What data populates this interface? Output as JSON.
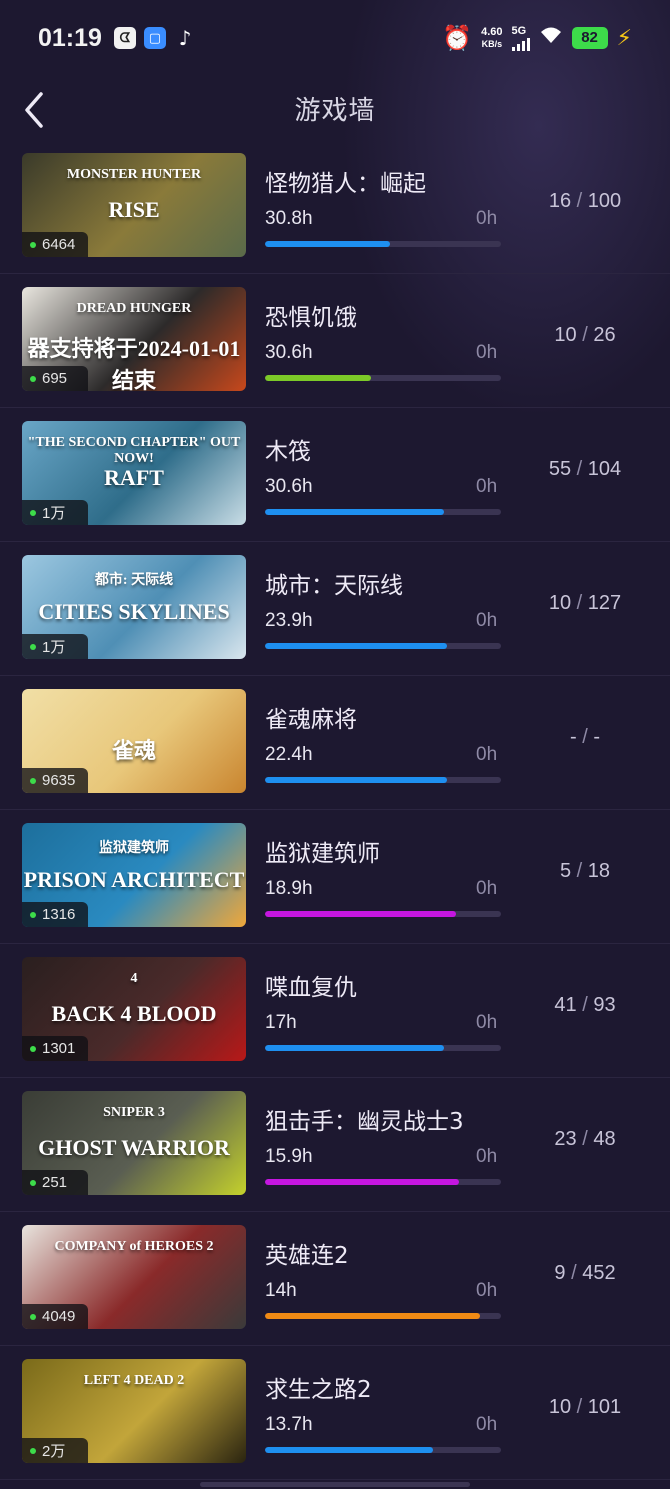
{
  "status_bar": {
    "time": "01:19",
    "app_icons": [
      "ᗧ",
      "▢",
      "♪"
    ],
    "net_speed_value": "4.60",
    "net_speed_unit": "KB/s",
    "network": "5G",
    "battery": "82"
  },
  "header": {
    "title": "游戏墙",
    "back_icon": "chevron-left-icon"
  },
  "colors": {
    "background": "#1d1830",
    "bar_blue": "#1e8ff0",
    "bar_green": "#7cc928",
    "bar_purple": "#c516e0",
    "bar_orange": "#f08a14",
    "track": "#3a3452",
    "online_dot": "#3ddc4a"
  },
  "games": [
    {
      "name": "怪物猎人：崛起",
      "hours": "30.8h",
      "recent": "0h",
      "online": "6464",
      "ach_done": "16",
      "ach_total": "100",
      "progress": 0.53,
      "bar_color": "#1e8ff0",
      "art": {
        "title_line1": "MONSTER HUNTER",
        "title_line2": "RISE",
        "palette": [
          "#3a3a2a",
          "#8a7a3a",
          "#5a6a4a"
        ]
      }
    },
    {
      "name": "恐惧饥饿",
      "hours": "30.6h",
      "recent": "0h",
      "online": "695",
      "ach_done": "10",
      "ach_total": "26",
      "progress": 0.45,
      "bar_color": "#7cc928",
      "art": {
        "title_line1": "DREAD HUNGER",
        "title_line2": "器支持将于2024-01-01结束",
        "palette": [
          "#e9e6df",
          "#2c2a2a",
          "#c7481c"
        ]
      }
    },
    {
      "name": "木筏",
      "hours": "30.6h",
      "recent": "0h",
      "online": "1万",
      "ach_done": "55",
      "ach_total": "104",
      "progress": 0.76,
      "bar_color": "#1e8ff0",
      "art": {
        "title_line1": "\"THE SECOND CHAPTER\" OUT NOW!",
        "title_line2": "RAFT",
        "palette": [
          "#6aa6c7",
          "#2f6d8a",
          "#c9dde6"
        ]
      }
    },
    {
      "name": "城市：天际线",
      "hours": "23.9h",
      "recent": "0h",
      "online": "1万",
      "ach_done": "10",
      "ach_total": "127",
      "progress": 0.77,
      "bar_color": "#1e8ff0",
      "art": {
        "title_line1": "都市: 天际线",
        "title_line2": "CITIES SKYLINES",
        "palette": [
          "#9cc7e0",
          "#4f8fb5",
          "#d9e6ee"
        ]
      }
    },
    {
      "name": "雀魂麻将",
      "hours": "22.4h",
      "recent": "0h",
      "online": "9635",
      "ach_done": "-",
      "ach_total": "-",
      "progress": 0.77,
      "bar_color": "#1e8ff0",
      "art": {
        "title_line1": "",
        "title_line2": "雀魂",
        "palette": [
          "#f1dfa6",
          "#e8c77a",
          "#c9852f"
        ]
      }
    },
    {
      "name": "监狱建筑师",
      "hours": "18.9h",
      "recent": "0h",
      "online": "1316",
      "ach_done": "5",
      "ach_total": "18",
      "progress": 0.81,
      "bar_color": "#c516e0",
      "art": {
        "title_line1": "监狱建筑师",
        "title_line2": "PRISON ARCHITECT",
        "palette": [
          "#1d6f9c",
          "#2a8ac0",
          "#f0a73a"
        ]
      }
    },
    {
      "name": "喋血复仇",
      "hours": "17h",
      "recent": "0h",
      "online": "1301",
      "ach_done": "41",
      "ach_total": "93",
      "progress": 0.76,
      "bar_color": "#1e8ff0",
      "art": {
        "title_line1": "4",
        "title_line2": "BACK 4 BLOOD",
        "palette": [
          "#2a1f1f",
          "#4a2a2a",
          "#b81818"
        ]
      }
    },
    {
      "name": "狙击手：幽灵战士3",
      "hours": "15.9h",
      "recent": "0h",
      "online": "251",
      "ach_done": "23",
      "ach_total": "48",
      "progress": 0.82,
      "bar_color": "#c516e0",
      "art": {
        "title_line1": "SNIPER 3",
        "title_line2": "GHOST WARRIOR",
        "palette": [
          "#3a3d36",
          "#5a5e52",
          "#c4d12c"
        ]
      }
    },
    {
      "name": "英雄连2",
      "hours": "14h",
      "recent": "0h",
      "online": "4049",
      "ach_done": "9",
      "ach_total": "452",
      "progress": 0.91,
      "bar_color": "#f08a14",
      "art": {
        "title_line1": "COMPANY of HEROES 2",
        "title_line2": "",
        "palette": [
          "#e8e4de",
          "#8a2a2a",
          "#3a3a3a"
        ]
      }
    },
    {
      "name": "求生之路2",
      "hours": "13.7h",
      "recent": "0h",
      "online": "2万",
      "ach_done": "10",
      "ach_total": "101",
      "progress": 0.71,
      "bar_color": "#1e8ff0",
      "art": {
        "title_line1": "LEFT 4 DEAD 2",
        "title_line2": "",
        "palette": [
          "#7a6a1a",
          "#c2a53a",
          "#2a2410"
        ]
      }
    }
  ]
}
